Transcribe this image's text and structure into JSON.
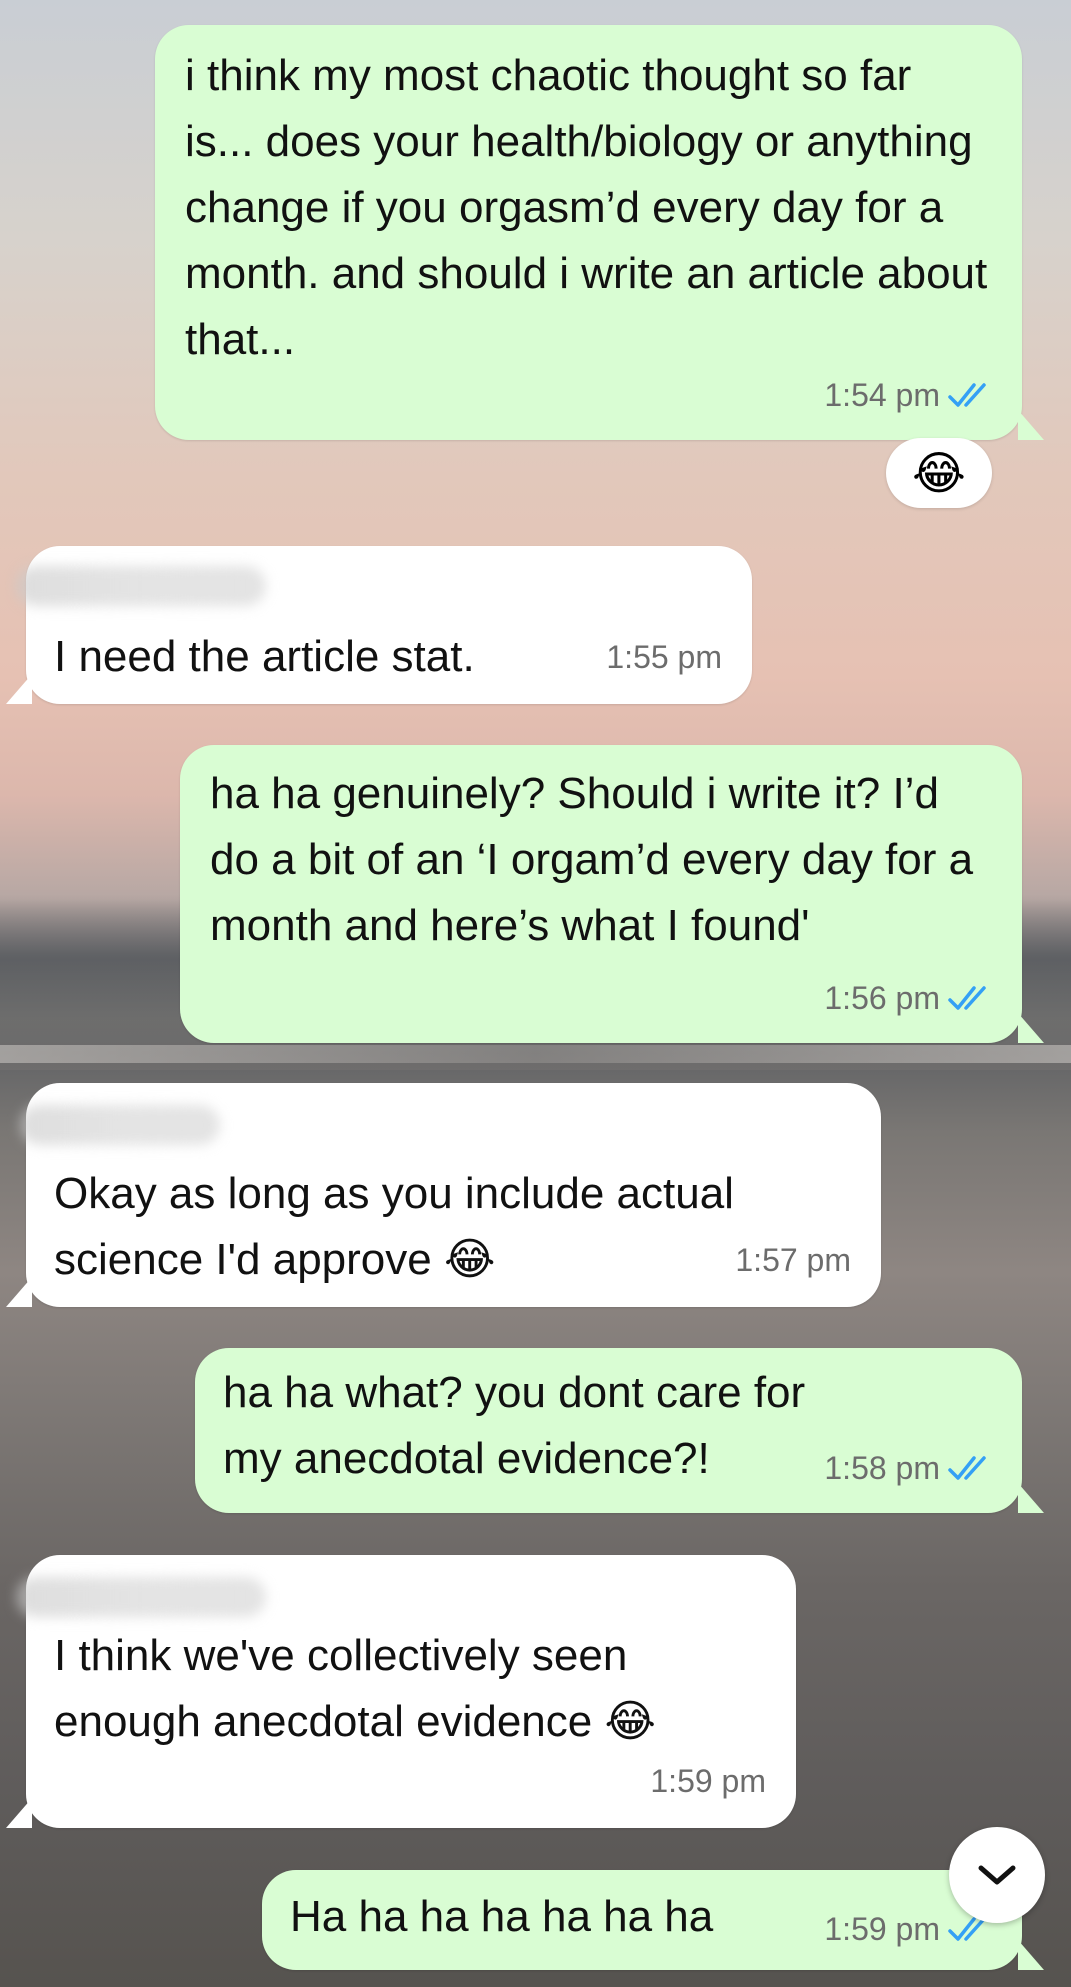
{
  "chat": {
    "messages": [
      {
        "direction": "outgoing",
        "text": "i think my most chaotic thought so far is... does your health/biology or anything change if you orgasm’d every day for a month. and should i write an article about that...",
        "time": "1:54 pm",
        "read": true,
        "reaction": "😂"
      },
      {
        "direction": "incoming",
        "text": "I need the article stat.",
        "time": "1:55 pm"
      },
      {
        "direction": "outgoing",
        "text": "ha ha genuinely? Should i write it? I’d do a bit of an ‘I orgam’d every day for a month and here’s what I found'",
        "time": "1:56 pm",
        "read": true
      },
      {
        "direction": "incoming",
        "text": "Okay as long as you include actual science I'd approve",
        "emoji": "😂",
        "time": "1:57 pm"
      },
      {
        "direction": "outgoing",
        "text": "ha ha what? you dont care for my anecdotal evidence?!",
        "time": "1:58 pm",
        "read": true
      },
      {
        "direction": "incoming",
        "text": "I think we've collectively seen enough anecdotal evidence",
        "emoji": "😂",
        "time": "1:59 pm"
      },
      {
        "direction": "outgoing",
        "text": "Ha ha ha ha ha ha ha",
        "time": "1:59 pm",
        "read": true
      }
    ]
  },
  "colors": {
    "outgoing_bubble": "#d9fdd3",
    "incoming_bubble": "#ffffff",
    "read_ticks": "#34a0f5",
    "timestamp": "#6c6c6c"
  },
  "icons": {
    "read_receipt": "double-check-icon",
    "reaction": "face-with-tears-of-joy",
    "scroll_down": "chevron-down-icon"
  }
}
